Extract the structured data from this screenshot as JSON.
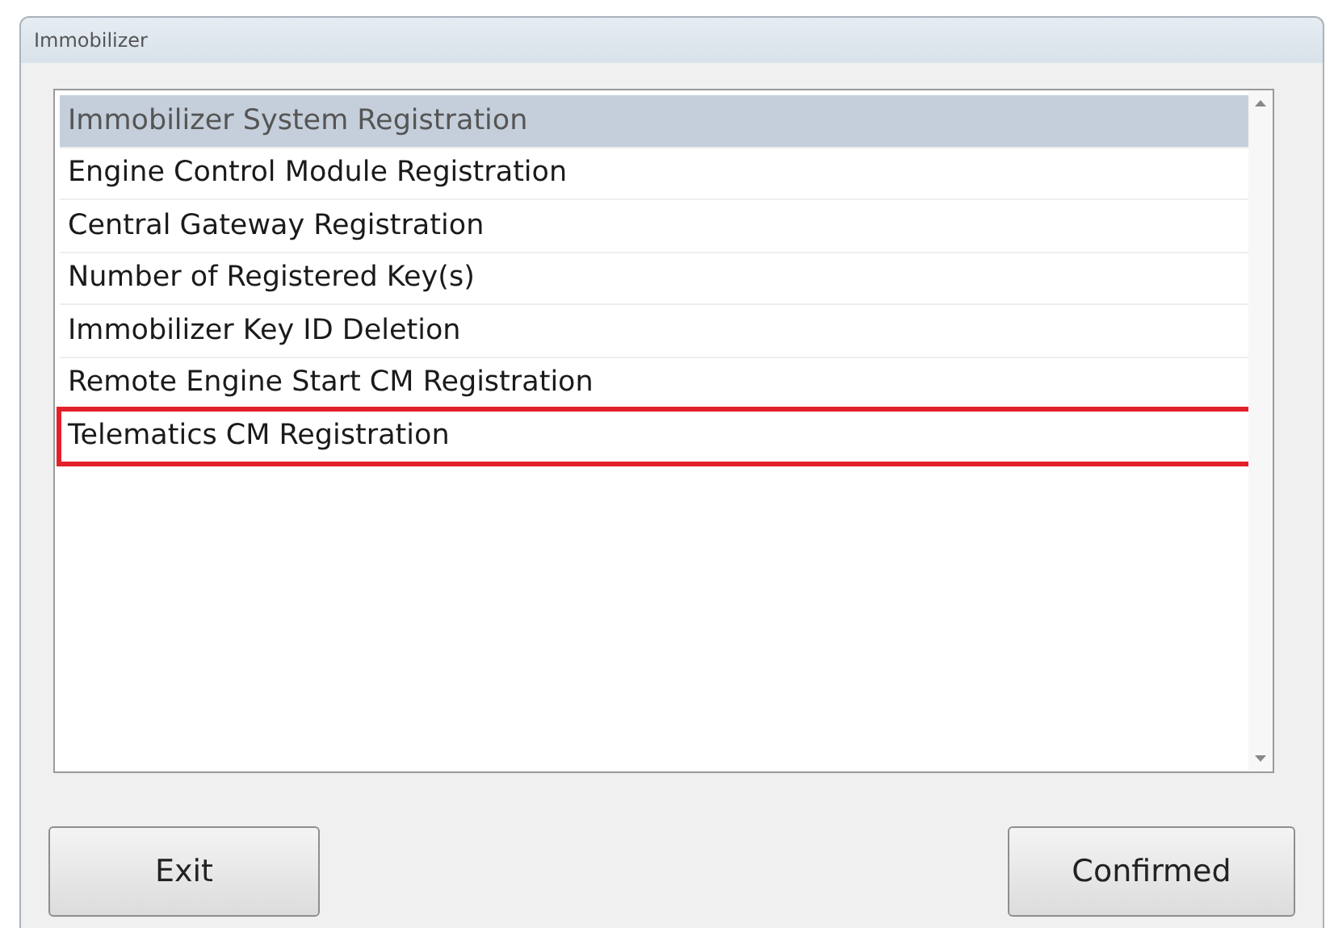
{
  "window": {
    "title": "Immobilizer"
  },
  "list": {
    "items": [
      {
        "label": "Immobilizer System Registration",
        "selected": true,
        "highlighted": false
      },
      {
        "label": "Engine Control Module Registration",
        "selected": false,
        "highlighted": false
      },
      {
        "label": "Central Gateway Registration",
        "selected": false,
        "highlighted": false
      },
      {
        "label": "Number of Registered Key(s)",
        "selected": false,
        "highlighted": false
      },
      {
        "label": "Immobilizer Key ID Deletion",
        "selected": false,
        "highlighted": false
      },
      {
        "label": "Remote Engine Start CM Registration",
        "selected": false,
        "highlighted": false
      },
      {
        "label": "Telematics CM Registration",
        "selected": false,
        "highlighted": true
      }
    ]
  },
  "buttons": [
    {
      "label": "Exit"
    },
    {
      "label": "Confirmed"
    }
  ]
}
